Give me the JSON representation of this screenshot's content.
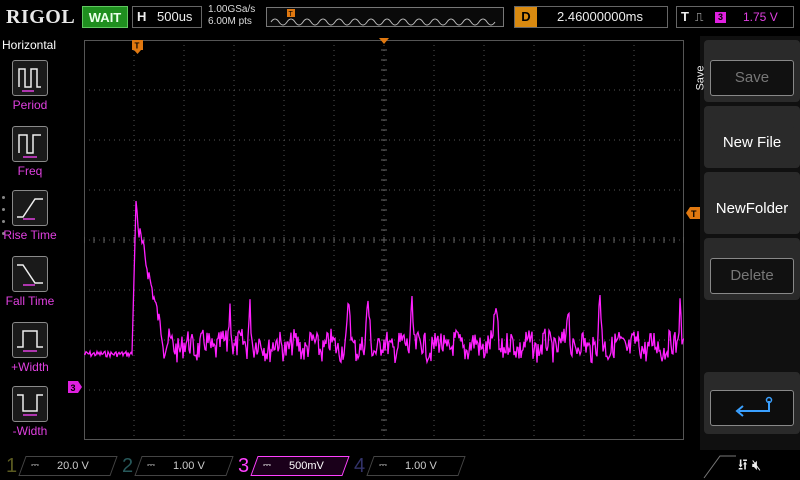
{
  "header": {
    "logo": "RIGOL",
    "status": "WAIT",
    "timebase_label": "H",
    "timebase_value": "500us",
    "sample_rate": "1.00GSa/s",
    "memory_depth": "6.00M pts",
    "delay_label": "D",
    "delay_value": "2.46000000ms",
    "trigger_label": "T",
    "trigger_source": "3",
    "trigger_level": "1.75 V"
  },
  "left_menu": {
    "title": "Horizontal",
    "items": [
      {
        "label": "Period"
      },
      {
        "label": "Freq"
      },
      {
        "label": "Rise Time"
      },
      {
        "label": "Fall Time"
      },
      {
        "label": "+Width"
      },
      {
        "label": "-Width"
      }
    ]
  },
  "right_menu": {
    "title": "Save",
    "buttons": [
      {
        "label": "Save",
        "enabled": false
      },
      {
        "label": "New File",
        "enabled": true
      },
      {
        "label": "NewFolder",
        "enabled": true
      },
      {
        "label": "Delete",
        "enabled": false
      },
      {
        "label": "",
        "icon": "return-arrow-icon"
      }
    ]
  },
  "channels": [
    {
      "num": "1",
      "scale": "20.0 V",
      "active": false
    },
    {
      "num": "2",
      "scale": "1.00 V",
      "active": false
    },
    {
      "num": "3",
      "scale": "500mV",
      "active": true
    },
    {
      "num": "4",
      "scale": "1.00 V",
      "active": false
    }
  ],
  "markers": {
    "trigger_marker": "T",
    "channel_marker": "3"
  },
  "colors": {
    "ch3": "#ff20ff",
    "trigger": "#ff8c00",
    "wait": "#1f8f1f"
  }
}
